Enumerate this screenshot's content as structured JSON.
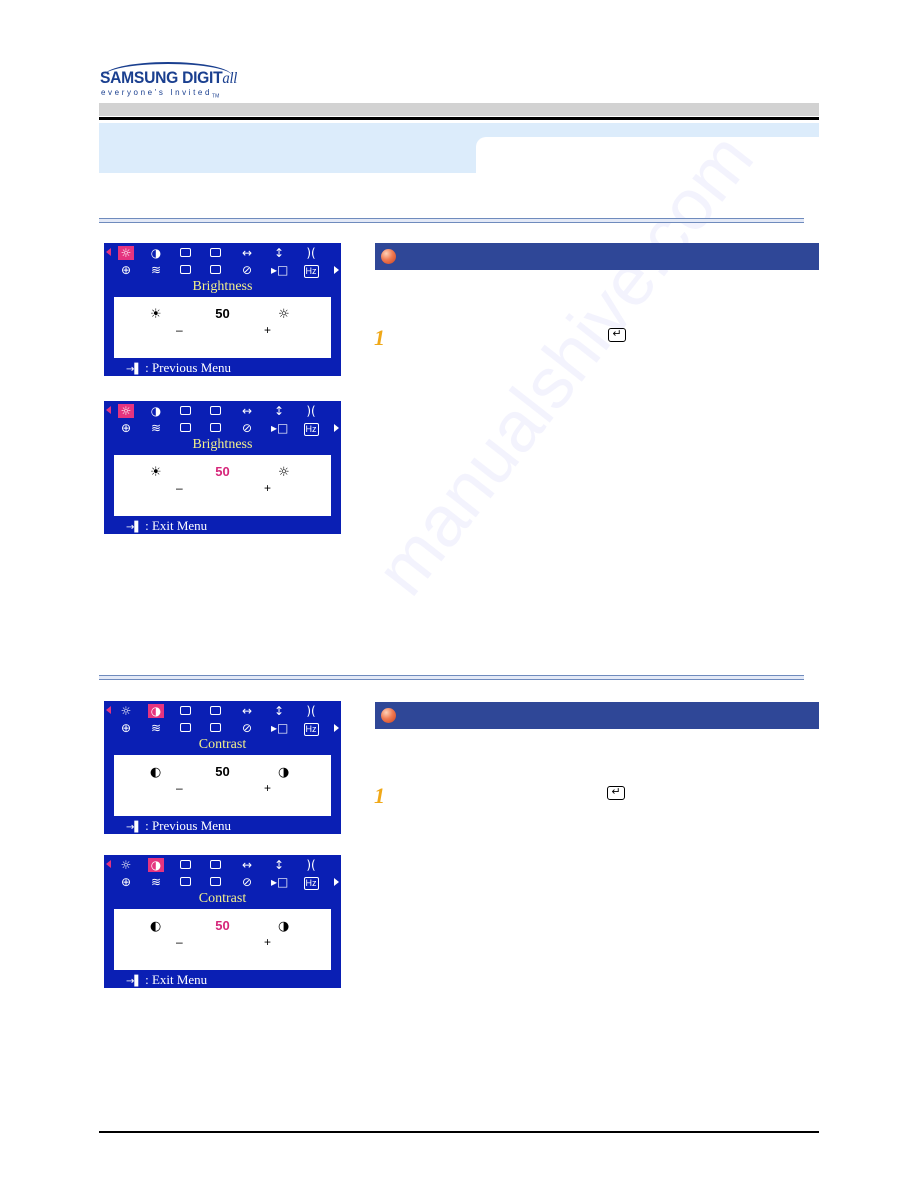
{
  "logo": {
    "brand": "SAMSUNG DIGIT",
    "brand_suffix": "all",
    "tagline": "everyone's Invited",
    "trademark": "TM"
  },
  "watermark": "manualshive.com",
  "sections": [
    {
      "id": "brightness",
      "osd_screens": [
        {
          "title": "Brightness",
          "value": "50",
          "value_active": false,
          "left_symbol_icon": "dim-sun-icon",
          "right_symbol_icon": "bright-sun-icon",
          "minus": "–",
          "plus": "+",
          "footer_label": ": Previous Menu"
        },
        {
          "title": "Brightness",
          "value": "50",
          "value_active": true,
          "left_symbol_icon": "dim-sun-icon",
          "right_symbol_icon": "bright-sun-icon",
          "minus": "–",
          "plus": "+",
          "footer_label": ": Exit Menu"
        }
      ],
      "selected_icon_index": 0,
      "step_number": "1",
      "enter_key_icon": "enter-key-icon"
    },
    {
      "id": "contrast",
      "osd_screens": [
        {
          "title": "Contrast",
          "value": "50",
          "value_active": false,
          "left_symbol_icon": "low-contrast-icon",
          "right_symbol_icon": "high-contrast-icon",
          "minus": "–",
          "plus": "+",
          "footer_label": ": Previous Menu"
        },
        {
          "title": "Contrast",
          "value": "50",
          "value_active": true,
          "left_symbol_icon": "low-contrast-icon",
          "right_symbol_icon": "high-contrast-icon",
          "minus": "–",
          "plus": "+",
          "footer_label": ": Exit Menu"
        }
      ],
      "selected_icon_index": 1,
      "step_number": "1",
      "enter_key_icon": "enter-key-icon"
    }
  ],
  "osd_menu_icons": {
    "row1": [
      "brightness-icon",
      "contrast-icon",
      "h-position-icon",
      "v-position-icon",
      "h-size-icon",
      "v-size-icon",
      "pincushion-icon"
    ],
    "row2": [
      "rotation-icon",
      "moire-icon",
      "parallelogram-icon",
      "trapezoid-icon",
      "degauss-icon",
      "video-icon",
      "hz-icon"
    ],
    "hz_label": "Hz"
  },
  "colors": {
    "osd_background": "#0a1fb4",
    "osd_selected": "#e5347f",
    "osd_title": "#f3f08a",
    "active_value": "#d6267a",
    "section_header": "#2f4797",
    "step_number": "#f0a818",
    "title_band": "#dcecfb"
  }
}
